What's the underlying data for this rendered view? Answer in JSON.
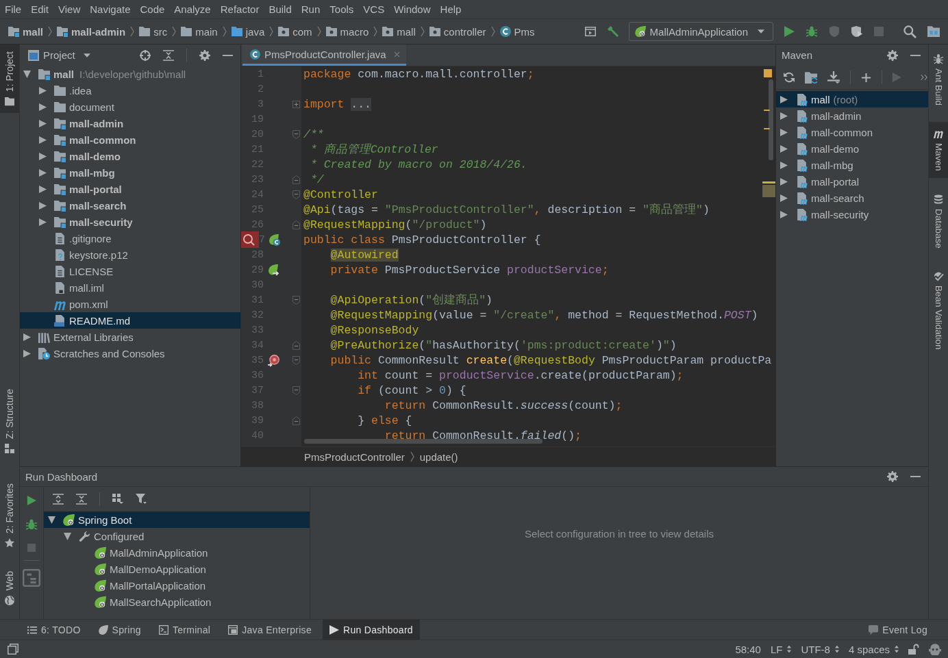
{
  "menu_bar": [
    "File",
    "Edit",
    "View",
    "Navigate",
    "Code",
    "Analyze",
    "Refactor",
    "Build",
    "Run",
    "Tools",
    "VCS",
    "Window",
    "Help"
  ],
  "navigation_bar": {
    "breadcrumbs": [
      {
        "label": "mall",
        "kind": "module"
      },
      {
        "label": "mall-admin",
        "kind": "module"
      },
      {
        "label": "src",
        "kind": "folder"
      },
      {
        "label": "main",
        "kind": "folder"
      },
      {
        "label": "java",
        "kind": "source"
      },
      {
        "label": "com",
        "kind": "package"
      },
      {
        "label": "macro",
        "kind": "package"
      },
      {
        "label": "mall",
        "kind": "package"
      },
      {
        "label": "controller",
        "kind": "package"
      },
      {
        "label": "Pms",
        "kind": "class"
      }
    ],
    "run_configuration": "MallAdminApplication"
  },
  "left_strip": [
    {
      "label": "1: Project",
      "kind": "project",
      "selected": true
    },
    {
      "label": "Z: Structure",
      "kind": "structure",
      "selected": false
    },
    {
      "label": "2: Favorites",
      "kind": "favorites",
      "selected": false
    },
    {
      "label": "Web",
      "kind": "web",
      "selected": false
    }
  ],
  "project_panel": {
    "title": "Project",
    "tree": [
      {
        "label": "mall",
        "path": "I:\\developer\\github\\mall",
        "kind": "module",
        "selected": false,
        "expanded": true,
        "children": [
          {
            "label": ".idea",
            "kind": "folder",
            "selected": false,
            "expanded": false
          },
          {
            "label": "document",
            "kind": "folder",
            "selected": false,
            "expanded": false
          },
          {
            "label": "mall-admin",
            "kind": "module",
            "selected": false,
            "expanded": false
          },
          {
            "label": "mall-common",
            "kind": "module",
            "selected": false,
            "expanded": false
          },
          {
            "label": "mall-demo",
            "kind": "module",
            "selected": false,
            "expanded": false
          },
          {
            "label": "mall-mbg",
            "kind": "module",
            "selected": false,
            "expanded": false
          },
          {
            "label": "mall-portal",
            "kind": "module",
            "selected": false,
            "expanded": false
          },
          {
            "label": "mall-search",
            "kind": "module",
            "selected": false,
            "expanded": false
          },
          {
            "label": "mall-security",
            "kind": "module",
            "selected": false,
            "expanded": false
          },
          {
            "label": ".gitignore",
            "kind": "text",
            "selected": false
          },
          {
            "label": "keystore.p12",
            "kind": "unknown",
            "selected": false
          },
          {
            "label": "LICENSE",
            "kind": "text",
            "selected": false
          },
          {
            "label": "mall.iml",
            "kind": "iml",
            "selected": false
          },
          {
            "label": "pom.xml",
            "kind": "maven",
            "selected": false
          },
          {
            "label": "README.md",
            "kind": "markdown",
            "selected": true
          }
        ]
      },
      {
        "label": "External Libraries",
        "kind": "libraries",
        "selected": false,
        "expanded": false
      },
      {
        "label": "Scratches and Consoles",
        "kind": "scratches",
        "selected": false,
        "expanded": false
      }
    ]
  },
  "editor": {
    "tabs": [
      {
        "label": "PmsProductController.java",
        "selected": true
      }
    ],
    "lines": [
      {
        "number": "1",
        "tokens": [
          {
            "kind": "kw",
            "text": "package"
          },
          {
            "kind": "plain",
            "text": " com.macro.mall.controller"
          },
          {
            "kind": "kw",
            "text": ";"
          }
        ]
      },
      {
        "number": "2"
      },
      {
        "number": "3",
        "marks": [
          {
            "kind": "fold-collapsed"
          }
        ],
        "tokens": [
          {
            "kind": "kw",
            "text": "import "
          },
          {
            "kind": "fold",
            "text": "..."
          }
        ]
      },
      {
        "number": "19"
      },
      {
        "number": "20",
        "marks": [
          {
            "kind": "fold-start"
          }
        ],
        "tokens": [
          {
            "kind": "doc",
            "text": "/**"
          }
        ]
      },
      {
        "number": "21",
        "tokens": [
          {
            "kind": "doc",
            "text": " * 商品管理Controller"
          }
        ]
      },
      {
        "number": "22",
        "tokens": [
          {
            "kind": "doc",
            "text": " * Created by macro on 2018/4/26."
          }
        ]
      },
      {
        "number": "23",
        "marks": [
          {
            "kind": "fold-end"
          }
        ],
        "tokens": [
          {
            "kind": "doc",
            "text": " */"
          }
        ]
      },
      {
        "number": "24",
        "marks": [
          {
            "kind": "fold-start"
          }
        ],
        "tokens": [
          {
            "kind": "ann",
            "text": "@Controller"
          }
        ]
      },
      {
        "number": "25",
        "tokens": [
          {
            "kind": "ann",
            "text": "@Api"
          },
          {
            "kind": "plain",
            "text": "(tags = "
          },
          {
            "kind": "str",
            "text": "\"PmsProductController\""
          },
          {
            "kind": "kw",
            "text": ","
          },
          {
            "kind": "plain",
            "text": " description = "
          },
          {
            "kind": "str",
            "text": "\"商品管理\""
          },
          {
            "kind": "plain",
            "text": ")"
          }
        ]
      },
      {
        "number": "26",
        "marks": [
          {
            "kind": "fold-end"
          }
        ],
        "tokens": [
          {
            "kind": "ann",
            "text": "@RequestMapping"
          },
          {
            "kind": "plain",
            "text": "("
          },
          {
            "kind": "str",
            "text": "\"/product\""
          },
          {
            "kind": "plain",
            "text": ")"
          }
        ]
      },
      {
        "number": "7",
        "marks": [
          {
            "kind": "search"
          },
          {
            "kind": "bean"
          }
        ],
        "tokens": [
          {
            "kind": "kw",
            "text": "public class"
          },
          {
            "kind": "plain",
            "text": " PmsProductController {"
          }
        ]
      },
      {
        "number": "28",
        "tokens": [
          {
            "kind": "usage",
            "text": "    @Autowired"
          }
        ]
      },
      {
        "number": "29",
        "marks": [
          {
            "kind": "autowired"
          }
        ],
        "tokens": [
          {
            "kind": "kw",
            "text": "    private"
          },
          {
            "kind": "plain",
            "text": " PmsProductService "
          },
          {
            "kind": "field",
            "text": "productService"
          },
          {
            "kind": "kw",
            "text": ";"
          }
        ]
      },
      {
        "number": "30"
      },
      {
        "number": "31",
        "marks": [
          {
            "kind": "fold-start"
          }
        ],
        "tokens": [
          {
            "kind": "ann",
            "text": "    @ApiOperation"
          },
          {
            "kind": "plain",
            "text": "("
          },
          {
            "kind": "str",
            "text": "\"创建商品\""
          },
          {
            "kind": "plain",
            "text": ")"
          }
        ]
      },
      {
        "number": "32",
        "tokens": [
          {
            "kind": "ann",
            "text": "    @RequestMapping"
          },
          {
            "kind": "plain",
            "text": "(value = "
          },
          {
            "kind": "str",
            "text": "\"/create\""
          },
          {
            "kind": "kw",
            "text": ","
          },
          {
            "kind": "plain",
            "text": " method = RequestMethod."
          },
          {
            "kind": "constant",
            "text": "POST"
          },
          {
            "kind": "plain",
            "text": ")"
          }
        ]
      },
      {
        "number": "33",
        "tokens": [
          {
            "kind": "ann",
            "text": "    @ResponseBody"
          }
        ]
      },
      {
        "number": "34",
        "marks": [
          {
            "kind": "fold-end"
          }
        ],
        "tokens": [
          {
            "kind": "ann",
            "text": "    @PreAuthorize"
          },
          {
            "kind": "plain",
            "text": "("
          },
          {
            "kind": "str",
            "text": "\""
          },
          {
            "kind": "plain",
            "text": "hasAuthority("
          },
          {
            "kind": "str",
            "text": "'pms:product:create'"
          },
          {
            "kind": "plain",
            "text": ")"
          },
          {
            "kind": "str",
            "text": "\""
          },
          {
            "kind": "plain",
            "text": ")"
          }
        ]
      },
      {
        "number": "35",
        "marks": [
          {
            "kind": "mapping"
          },
          {
            "kind": "fold-start"
          }
        ],
        "tokens": [
          {
            "kind": "kw",
            "text": "    public"
          },
          {
            "kind": "plain",
            "text": " CommonResult "
          },
          {
            "kind": "method",
            "text": "create"
          },
          {
            "kind": "plain",
            "text": "("
          },
          {
            "kind": "ann",
            "text": "@RequestBody"
          },
          {
            "kind": "plain",
            "text": " PmsProductParam productPa"
          }
        ]
      },
      {
        "number": "36",
        "tokens": [
          {
            "kind": "kw",
            "text": "        int"
          },
          {
            "kind": "plain",
            "text": " count = "
          },
          {
            "kind": "field",
            "text": "productService"
          },
          {
            "kind": "plain",
            "text": ".create(productParam)"
          },
          {
            "kind": "kw",
            "text": ";"
          }
        ]
      },
      {
        "number": "37",
        "marks": [
          {
            "kind": "fold-start"
          }
        ],
        "tokens": [
          {
            "kind": "kw",
            "text": "        if"
          },
          {
            "kind": "plain",
            "text": " (count > "
          },
          {
            "kind": "num",
            "text": "0"
          },
          {
            "kind": "plain",
            "text": ") {"
          }
        ]
      },
      {
        "number": "38",
        "tokens": [
          {
            "kind": "kw",
            "text": "            return"
          },
          {
            "kind": "plain",
            "text": " CommonResult."
          },
          {
            "kind": "italic",
            "text": "success"
          },
          {
            "kind": "plain",
            "text": "(count)"
          },
          {
            "kind": "kw",
            "text": ";"
          }
        ]
      },
      {
        "number": "39",
        "marks": [
          {
            "kind": "fold-end"
          }
        ],
        "tokens": [
          {
            "kind": "plain",
            "text": "        } "
          },
          {
            "kind": "kw",
            "text": "else"
          },
          {
            "kind": "plain",
            "text": " {"
          }
        ]
      },
      {
        "number": "40",
        "tokens": [
          {
            "kind": "kw",
            "text": "            return"
          },
          {
            "kind": "plain",
            "text": " CommonResult."
          },
          {
            "kind": "italic",
            "text": "failed"
          },
          {
            "kind": "plain",
            "text": "()"
          },
          {
            "kind": "kw",
            "text": ";"
          }
        ]
      }
    ],
    "breadcrumbs": [
      "PmsProductController",
      "update()"
    ]
  },
  "maven_panel": {
    "title": "Maven",
    "projects": [
      {
        "label": "mall",
        "note": "(root)",
        "selected": true,
        "expanded": false
      },
      {
        "label": "mall-admin",
        "selected": false,
        "expanded": false
      },
      {
        "label": "mall-common",
        "selected": false,
        "expanded": false
      },
      {
        "label": "mall-demo",
        "selected": false,
        "expanded": false
      },
      {
        "label": "mall-mbg",
        "selected": false,
        "expanded": false
      },
      {
        "label": "mall-portal",
        "selected": false,
        "expanded": false
      },
      {
        "label": "mall-search",
        "selected": false,
        "expanded": false
      },
      {
        "label": "mall-security",
        "selected": false,
        "expanded": false
      }
    ]
  },
  "right_strip": [
    {
      "label": "Ant Build",
      "kind": "ant",
      "selected": false
    },
    {
      "label": "Maven",
      "kind": "maven",
      "selected": true
    },
    {
      "label": "Database",
      "kind": "database",
      "selected": false
    },
    {
      "label": "Bean Validation",
      "kind": "bean",
      "selected": false
    }
  ],
  "run_dashboard": {
    "title": "Run Dashboard",
    "tree": [
      {
        "label": "Spring Boot",
        "kind": "spring-boot",
        "selected": true,
        "expanded": true,
        "children": [
          {
            "label": "Configured",
            "kind": "group",
            "selected": false,
            "expanded": true,
            "children": [
              {
                "label": "MallAdminApplication",
                "kind": "app",
                "selected": false
              },
              {
                "label": "MallDemoApplication",
                "kind": "app",
                "selected": false
              },
              {
                "label": "MallPortalApplication",
                "kind": "app",
                "selected": false
              },
              {
                "label": "MallSearchApplication",
                "kind": "app",
                "selected": false
              }
            ]
          }
        ]
      }
    ],
    "details_hint": "Select configuration in tree to view details"
  },
  "tool_window_bar": {
    "left": [
      {
        "label": "6: TODO",
        "kind": "todo",
        "selected": false
      },
      {
        "label": "Spring",
        "kind": "spring",
        "selected": false
      },
      {
        "label": "Terminal",
        "kind": "terminal",
        "selected": false
      },
      {
        "label": "Java Enterprise",
        "kind": "javaee",
        "selected": false
      },
      {
        "label": "Run Dashboard",
        "kind": "run",
        "selected": true
      }
    ],
    "right": [
      {
        "label": "Event Log",
        "kind": "log",
        "selected": false
      }
    ]
  },
  "status_bar": [
    {
      "text": "58:40",
      "dropdown": false
    },
    {
      "text": "LF",
      "dropdown": true
    },
    {
      "text": "UTF-8",
      "dropdown": true
    },
    {
      "text": "4 spaces",
      "dropdown": true
    }
  ]
}
